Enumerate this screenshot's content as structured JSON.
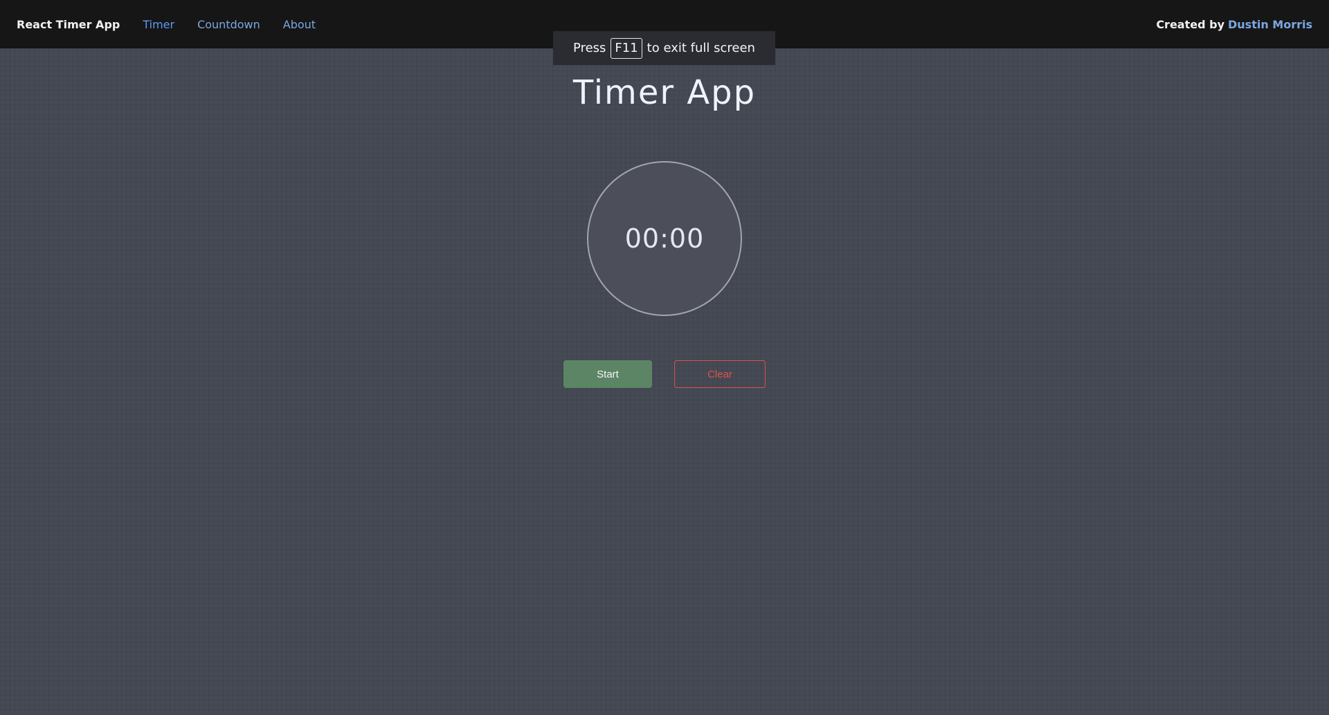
{
  "nav": {
    "brand": "React Timer App",
    "links": [
      {
        "label": "Timer",
        "active": true
      },
      {
        "label": "Countdown",
        "active": false
      },
      {
        "label": "About",
        "active": false
      }
    ],
    "credit_prefix": "Created by",
    "credit_name": "Dustin Morris"
  },
  "fullscreen_notice": {
    "prefix": "Press",
    "key": "F11",
    "suffix": "to exit full screen"
  },
  "main": {
    "title": "Timer App",
    "timer_value": "00:00",
    "start_label": "Start",
    "clear_label": "Clear"
  },
  "colors": {
    "accent_link": "#7ba7e0",
    "start_button": "#5c8565",
    "clear_button": "#e0524a",
    "topbar": "#161616"
  }
}
